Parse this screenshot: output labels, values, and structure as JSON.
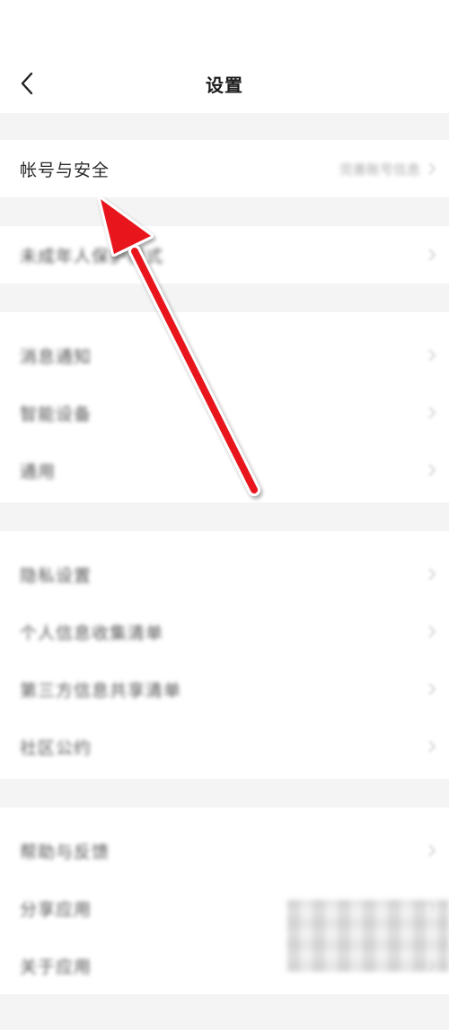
{
  "header": {
    "title": "设置"
  },
  "groups": [
    {
      "items": [
        {
          "label": "帐号与安全",
          "value": "完善账号信息"
        }
      ]
    },
    {
      "items": [
        {
          "label": "未成年人保护模式"
        }
      ]
    },
    {
      "items": [
        {
          "label": "消息通知"
        },
        {
          "label": "智能设备"
        },
        {
          "label": "通用"
        }
      ]
    },
    {
      "items": [
        {
          "label": "隐私设置"
        },
        {
          "label": "个人信息收集清单"
        },
        {
          "label": "第三方信息共享清单"
        },
        {
          "label": "社区公约"
        }
      ]
    },
    {
      "items": [
        {
          "label": "帮助与反馈"
        },
        {
          "label": "分享应用"
        },
        {
          "label": "关于应用"
        }
      ]
    }
  ],
  "annotation": {
    "color": "#e8141c"
  },
  "icons": {
    "back": "chevron-left-icon",
    "row": "chevron-right-icon"
  }
}
